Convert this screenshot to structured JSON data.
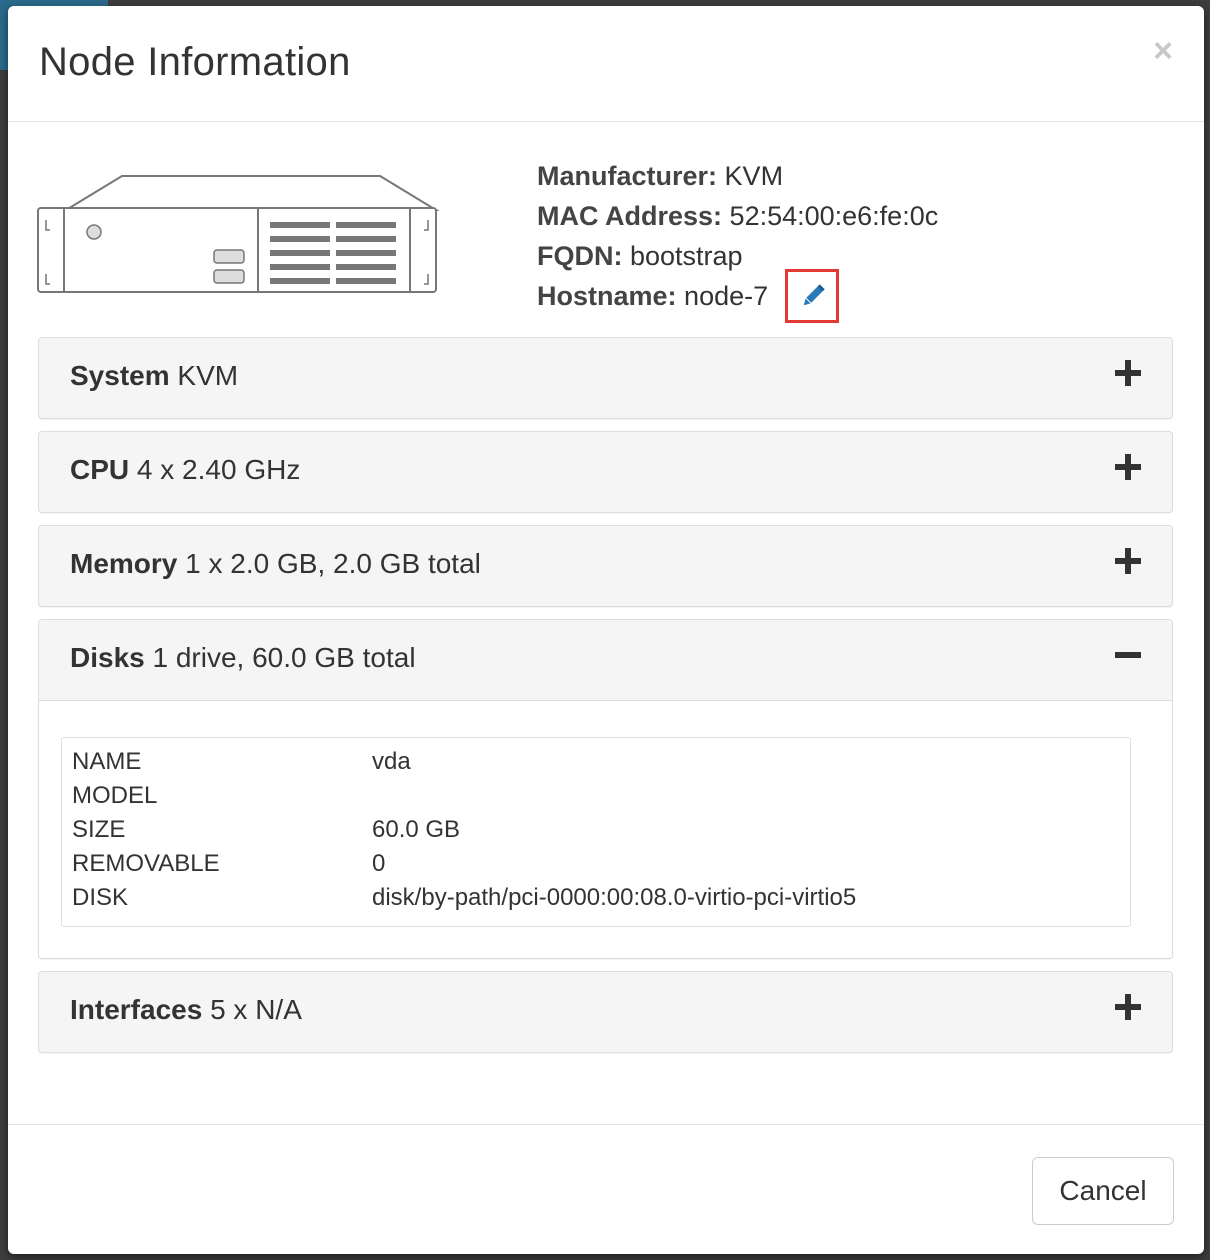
{
  "modal": {
    "title": "Node Information",
    "close_label": "×"
  },
  "info": {
    "manufacturer_key": "Manufacturer:",
    "manufacturer_val": "KVM",
    "mac_key": "MAC Address:",
    "mac_val": "52:54:00:e6:fe:0c",
    "fqdn_key": "FQDN:",
    "fqdn_val": "bootstrap",
    "hostname_key": "Hostname:",
    "hostname_val": "node-7",
    "edit_icon": "pencil-icon",
    "highlight_color": "#e53935",
    "edit_icon_color": "#2a7ab8"
  },
  "panels": {
    "system": {
      "label": "System",
      "summary": "KVM",
      "state": "collapsed"
    },
    "cpu": {
      "label": "CPU",
      "summary": "4 x 2.40 GHz",
      "state": "collapsed"
    },
    "memory": {
      "label": "Memory",
      "summary": "1 x 2.0 GB, 2.0 GB total",
      "state": "collapsed"
    },
    "disks": {
      "label": "Disks",
      "summary": "1 drive, 60.0 GB total",
      "state": "expanded",
      "rows": [
        {
          "key": "NAME",
          "value": "vda"
        },
        {
          "key": "MODEL",
          "value": ""
        },
        {
          "key": "SIZE",
          "value": "60.0 GB"
        },
        {
          "key": "REMOVABLE",
          "value": "0"
        },
        {
          "key": "DISK",
          "value": "disk/by-path/pci-0000:00:08.0-virtio-pci-virtio5"
        }
      ]
    },
    "interfaces": {
      "label": "Interfaces",
      "summary": "5 x N/A",
      "state": "collapsed"
    }
  },
  "footer": {
    "cancel_label": "Cancel"
  }
}
